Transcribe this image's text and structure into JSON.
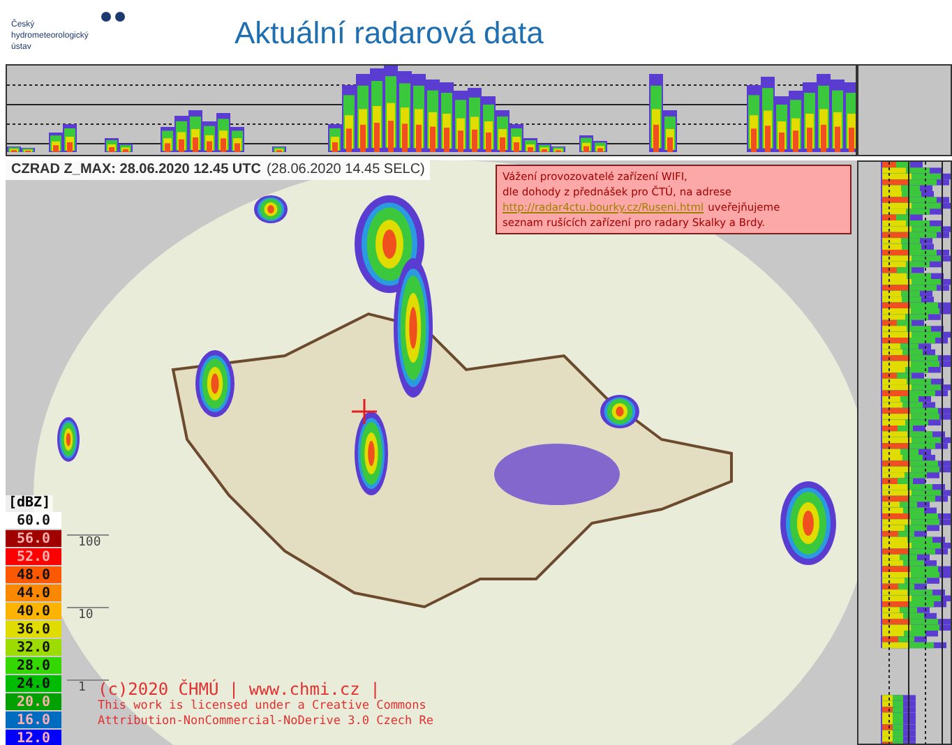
{
  "logo": {
    "text": "Český hydrometeorologický ústav"
  },
  "title": "Aktuální radarová data",
  "map": {
    "caption_bold": "CZRAD Z_MAX: 28.06.2020 12.45 UTC",
    "caption_local": "(28.06.2020 14.45 SELC)",
    "notice": {
      "line_1": "Vážení provozovatelé zařízení WIFI,",
      "line_2": "dle dohody z přednášek pro ČTÚ, na adrese",
      "link": "http://radar4ctu.bourky.cz/Ruseni.html",
      "after_link": "uveřejňujeme",
      "line_4": "seznam rušících zařízení pro radary Skalky a Brdy."
    },
    "legend": {
      "unit": "[dBZ]",
      "items": [
        {
          "value": "60.0",
          "color": "#ffffff"
        },
        {
          "value": "56.0",
          "color": "#a00000"
        },
        {
          "value": "52.0",
          "color": "#fc0000"
        },
        {
          "value": "48.0",
          "color": "#fc5800"
        },
        {
          "value": "44.0",
          "color": "#fc8800"
        },
        {
          "value": "40.0",
          "color": "#fcb400"
        },
        {
          "value": "36.0",
          "color": "#e0dc00"
        },
        {
          "value": "32.0",
          "color": "#9cdc00"
        },
        {
          "value": "28.0",
          "color": "#34d800"
        },
        {
          "value": "24.0",
          "color": "#00bc00"
        },
        {
          "value": "20.0",
          "color": "#00a000"
        },
        {
          "value": "16.0",
          "color": "#006cc0"
        },
        {
          "value": "12.0",
          "color": "#0000fc"
        }
      ],
      "rain_ticks": [
        "100",
        "10",
        "1"
      ]
    },
    "copyright": [
      "(c)2020 ČHMÚ | www.chmi.cz |",
      "This work is licensed under a Creative Commons",
      "Attribution-NonCommercial-NoDerive 3.0 Czech Re"
    ]
  }
}
